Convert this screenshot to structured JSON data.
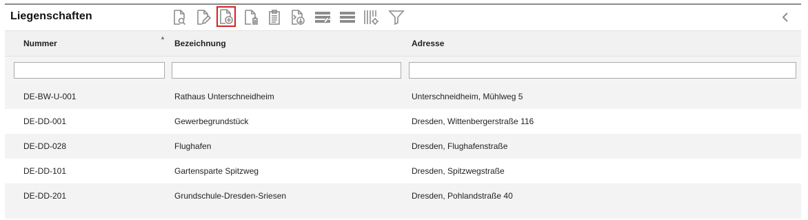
{
  "panel": {
    "title": "Liegenschaften",
    "toolbar": [
      {
        "name": "view-details-icon"
      },
      {
        "name": "edit-document-icon"
      },
      {
        "name": "add-document-icon"
      },
      {
        "name": "delete-document-icon"
      },
      {
        "name": "clipboard-icon"
      },
      {
        "name": "export-document-icon"
      },
      {
        "name": "edit-rows-icon"
      },
      {
        "name": "list-rows-icon"
      },
      {
        "name": "column-settings-icon"
      },
      {
        "name": "filter-icon"
      }
    ],
    "collapse_icon": "chevron-left-icon"
  },
  "table": {
    "columns": [
      "Nummer",
      "Bezeichnung",
      "Adresse"
    ],
    "sorted_column": "Nummer",
    "filters": [
      "",
      "",
      ""
    ],
    "rows": [
      {
        "nummer": "DE-BW-U-001",
        "bezeichnung": "Rathaus Unterschneidheim",
        "adresse": "Unterschneidheim, Mühlweg 5"
      },
      {
        "nummer": "DE-DD-001",
        "bezeichnung": "Gewerbegrundstück",
        "adresse": "Dresden, Wittenbergerstraße 116"
      },
      {
        "nummer": "DE-DD-028",
        "bezeichnung": "Flughafen",
        "adresse": "Dresden, Flughafenstraße"
      },
      {
        "nummer": "DE-DD-101",
        "bezeichnung": "Gartensparte Spitzweg",
        "adresse": "Dresden, Spitzwegstraße"
      },
      {
        "nummer": "DE-DD-201",
        "bezeichnung": "Grundschule-Dresden-Sriesen",
        "adresse": "Dresden, Pohlandstraße 40"
      }
    ]
  },
  "colors": {
    "active_tool_border": "#d32020",
    "icon_gray": "#8c8c8c",
    "row_alt": "#f3f3f3",
    "header_bg": "#f1f1f1"
  }
}
